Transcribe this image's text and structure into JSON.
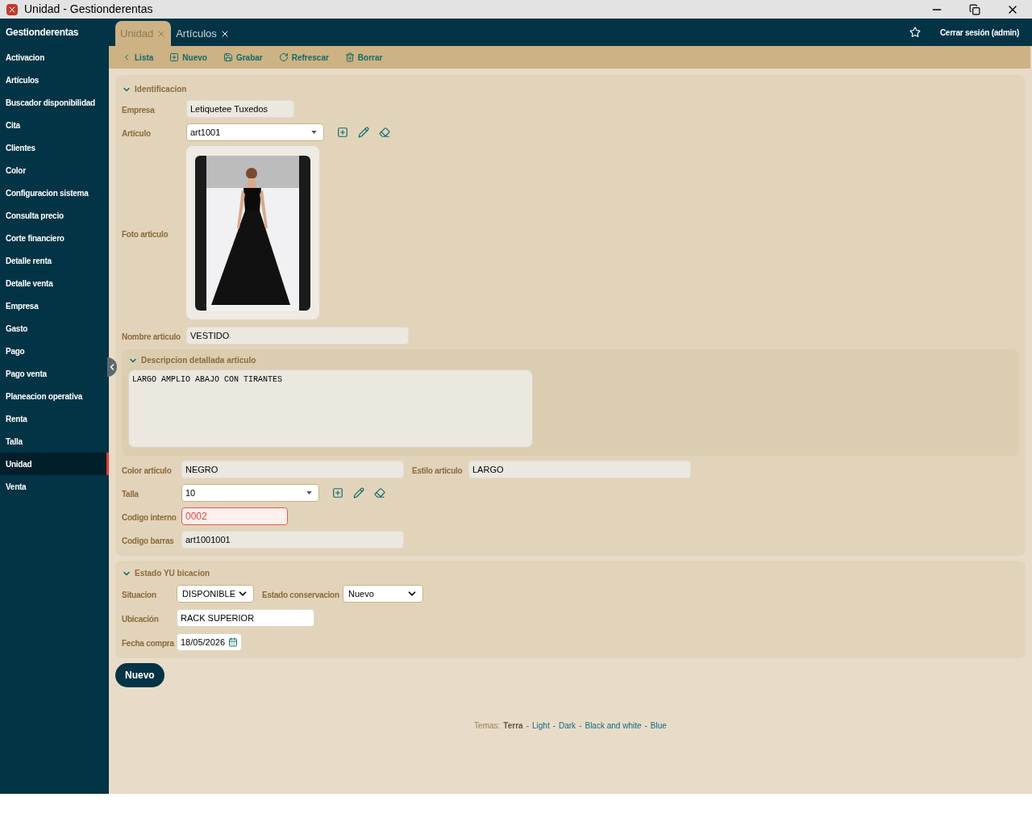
{
  "title_bar": {
    "title": "Unidad - Gestionderentas"
  },
  "sidebar": {
    "brand": "Gestionderentas",
    "items": [
      {
        "label": "Activacion",
        "selected": false
      },
      {
        "label": "Artículos",
        "selected": false
      },
      {
        "label": "Buscador disponibilidad",
        "selected": false
      },
      {
        "label": "Cita",
        "selected": false
      },
      {
        "label": "Clientes",
        "selected": false
      },
      {
        "label": "Color",
        "selected": false
      },
      {
        "label": "Configuracion sistema",
        "selected": false
      },
      {
        "label": "Consulta precio",
        "selected": false
      },
      {
        "label": "Corte financiero",
        "selected": false
      },
      {
        "label": "Detalle renta",
        "selected": false
      },
      {
        "label": "Detalle venta",
        "selected": false
      },
      {
        "label": "Empresa",
        "selected": false
      },
      {
        "label": "Gasto",
        "selected": false
      },
      {
        "label": "Pago",
        "selected": false
      },
      {
        "label": "Pago venta",
        "selected": false
      },
      {
        "label": "Planeacion operativa",
        "selected": false
      },
      {
        "label": "Renta",
        "selected": false
      },
      {
        "label": "Talla",
        "selected": false
      },
      {
        "label": "Unidad",
        "selected": true
      },
      {
        "label": "Venta",
        "selected": false
      }
    ]
  },
  "tabs": [
    {
      "label": "Unidad",
      "selected": true
    },
    {
      "label": "Artículos",
      "selected": false
    }
  ],
  "header": {
    "logout": "Cerrar sesión (admin)"
  },
  "toolbar": [
    {
      "label": "Lista",
      "kind": "back"
    },
    {
      "label": "Nuevo",
      "kind": "add"
    },
    {
      "label": "Grabar",
      "kind": "save"
    },
    {
      "label": "Refrescar",
      "kind": "refresh"
    },
    {
      "label": "Borrar",
      "kind": "delete"
    }
  ],
  "identificacion": {
    "title": "Identificacion",
    "expanded": true,
    "empresa": {
      "label": "Empresa",
      "value": "Letiquetee Tuxedos"
    },
    "articulo": {
      "label": "Artículo",
      "value": "art1001"
    },
    "foto": {
      "label": "Foto articulo"
    },
    "nombre": {
      "label": "Nombre articulo",
      "value": "VESTIDO"
    },
    "descripcion": {
      "title": "Descripcion detallada articulo",
      "expanded": true,
      "value": "LARGO AMPLIO ABAJO CON TIRANTES"
    },
    "color": {
      "label": "Color articulo",
      "value": "NEGRO"
    },
    "estilo": {
      "label": "Estilo articulo",
      "value": "LARGO"
    },
    "talla": {
      "label": "Talla",
      "value": "10"
    },
    "codigo_interno": {
      "label": "Codigo interno",
      "value": "0002",
      "error": true
    },
    "codigo_barras": {
      "label": "Codigo barras",
      "value": "art1001001"
    }
  },
  "estado": {
    "title": "Estado YU bicacion",
    "expanded": true,
    "situacion": {
      "label": "Situacion",
      "value": "DISPONIBLE"
    },
    "conservacion": {
      "label": "Estado conservacion",
      "value": "Nuevo"
    },
    "ubicacion": {
      "label": "Ubicación",
      "value": "RACK SUPERIOR"
    },
    "fecha": {
      "label": "Fecha compra",
      "value": "18/05/2026"
    }
  },
  "new_button": "Nuevo",
  "themes": {
    "label": "Temas:",
    "separator": "-",
    "items": [
      {
        "label": "Terra",
        "selected": true
      },
      {
        "label": "Light",
        "selected": false
      },
      {
        "label": "Dark",
        "selected": false
      },
      {
        "label": "Black and white",
        "selected": false
      },
      {
        "label": "Blue",
        "selected": false
      }
    ]
  }
}
